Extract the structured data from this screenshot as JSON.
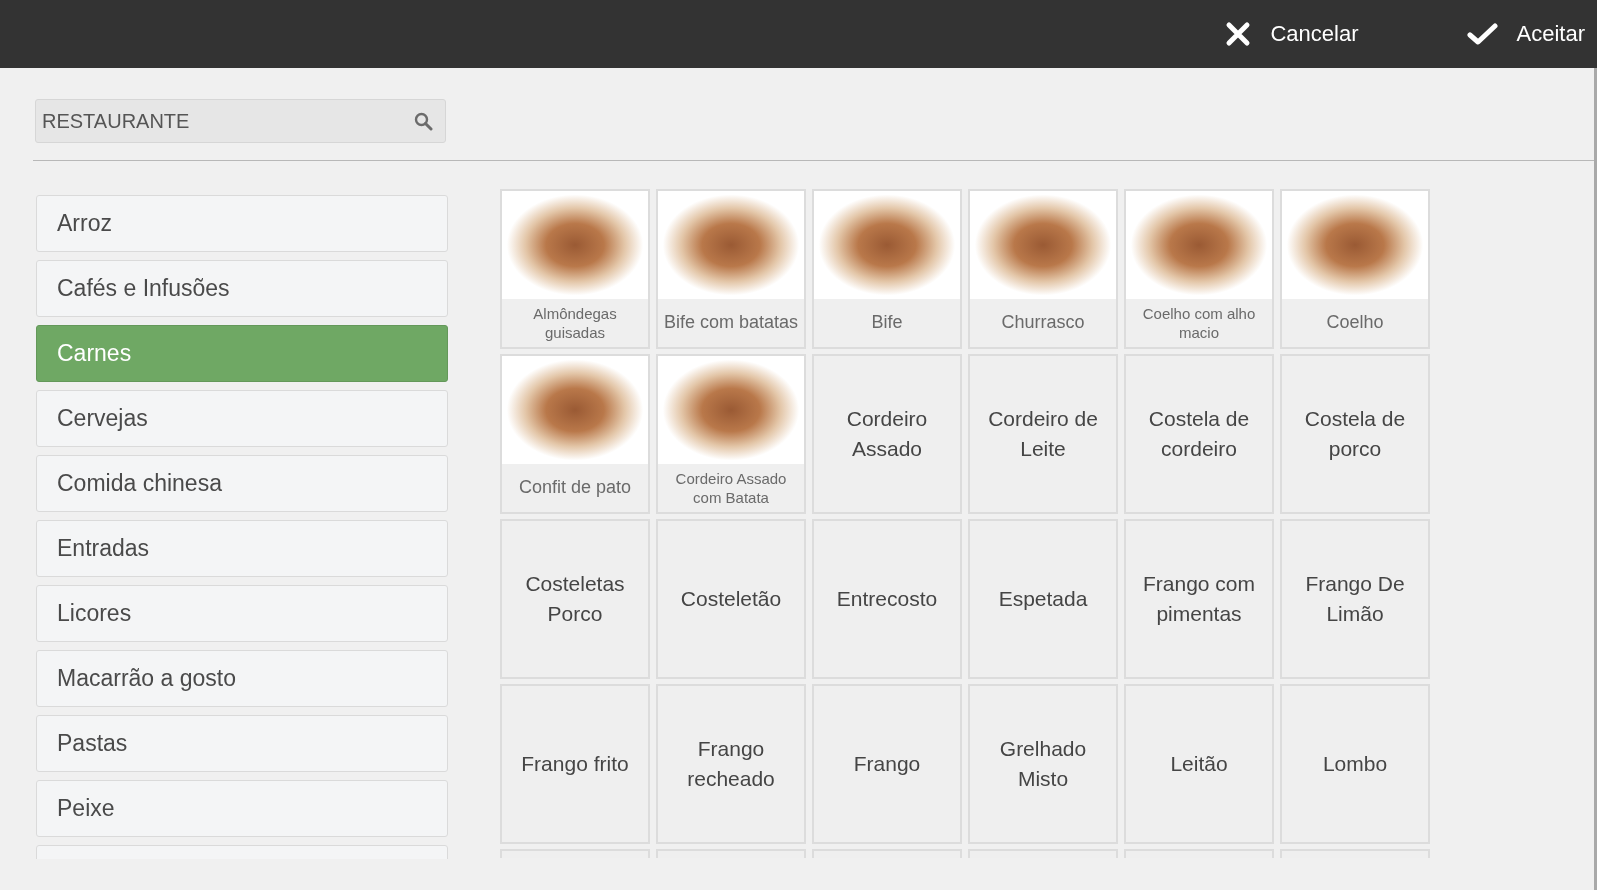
{
  "toolbar": {
    "buttons": [
      {
        "kind": "cancel",
        "label": "Cancelar"
      },
      {
        "kind": "accept",
        "label": "Aceitar"
      }
    ]
  },
  "search": {
    "value": "RESTAURANTE"
  },
  "categories": [
    {
      "kind": "item",
      "label": "Arroz",
      "selected": false
    },
    {
      "kind": "item",
      "label": "Cafés e Infusões",
      "selected": false
    },
    {
      "kind": "item",
      "label": "Carnes",
      "selected": true
    },
    {
      "kind": "item",
      "label": "Cervejas",
      "selected": false
    },
    {
      "kind": "item",
      "label": "Comida chinesa",
      "selected": false
    },
    {
      "kind": "item",
      "label": "Entradas",
      "selected": false
    },
    {
      "kind": "item",
      "label": "Licores",
      "selected": false
    },
    {
      "kind": "item",
      "label": "Macarrão a gosto",
      "selected": false
    },
    {
      "kind": "item",
      "label": "Pastas",
      "selected": false
    },
    {
      "kind": "item",
      "label": "Peixe",
      "selected": false
    },
    {
      "kind": "clipped",
      "selected": false
    }
  ],
  "products": [
    {
      "kind": "photo",
      "name": "Almôndegas guisadas"
    },
    {
      "kind": "photo",
      "name": "Bife com batatas"
    },
    {
      "kind": "photo",
      "name": "Bife"
    },
    {
      "kind": "photo",
      "name": "Churrasco"
    },
    {
      "kind": "photo",
      "name": "Coelho com alho macio"
    },
    {
      "kind": "photo",
      "name": "Coelho"
    },
    {
      "kind": "photo",
      "name": "Confit de pato"
    },
    {
      "kind": "photo",
      "name": "Cordeiro Assado com Batata"
    },
    {
      "kind": "text",
      "name": "Cordeiro Assado"
    },
    {
      "kind": "text",
      "name": "Cordeiro de Leite"
    },
    {
      "kind": "text",
      "name": "Costela de cordeiro"
    },
    {
      "kind": "text",
      "name": "Costela de porco"
    },
    {
      "kind": "text",
      "name": "Costeletas Porco"
    },
    {
      "kind": "text",
      "name": "Costeletão"
    },
    {
      "kind": "text",
      "name": "Entrecosto"
    },
    {
      "kind": "text",
      "name": "Espetada"
    },
    {
      "kind": "text",
      "name": "Frango com pimentas"
    },
    {
      "kind": "text",
      "name": "Frango De Limão"
    },
    {
      "kind": "text",
      "name": "Frango frito"
    },
    {
      "kind": "text",
      "name": "Frango recheado"
    },
    {
      "kind": "text",
      "name": "Frango"
    },
    {
      "kind": "text",
      "name": "Grelhado Misto"
    },
    {
      "kind": "text",
      "name": "Leitão"
    },
    {
      "kind": "text",
      "name": "Lombo"
    },
    {
      "kind": "clipped"
    },
    {
      "kind": "clipped"
    },
    {
      "kind": "clipped"
    },
    {
      "kind": "clipped"
    },
    {
      "kind": "clipped"
    },
    {
      "kind": "clipped"
    }
  ]
}
